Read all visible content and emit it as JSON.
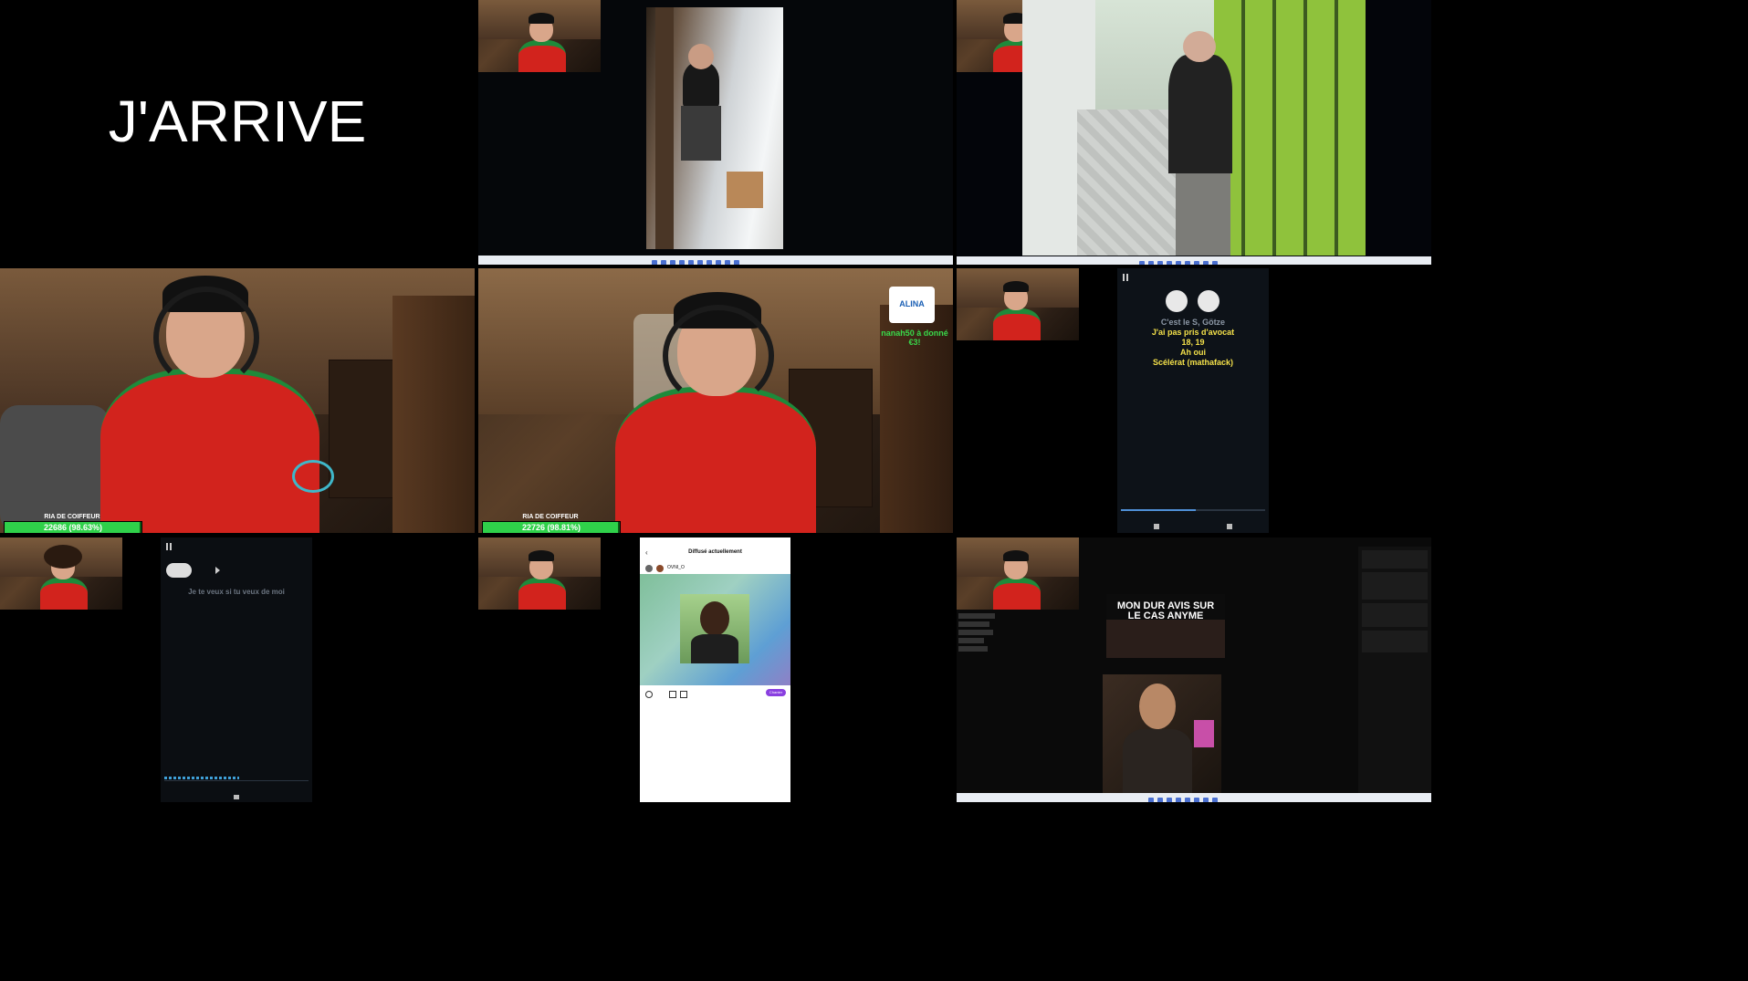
{
  "tiles": {
    "t1": {
      "big_text": "J'ARRIVE"
    },
    "t5": {
      "hp_label": "RIA DE COIFFEUR",
      "hp_text": "22686 (98.63%)",
      "hp_progress": 0.9863
    },
    "t6": {
      "hp_label": "RIA DE COIFFEUR",
      "hp_text": "22726 (98.81%)",
      "hp_progress": 0.9881,
      "donation_logo": "ALINA",
      "donation_text": "nanah50 à donné €3!"
    },
    "t7": {
      "lyrics": [
        "C'est le S, Götze",
        "J'ai pas pris d'avocat",
        "18, 19",
        "Ah oui",
        "Scélérat (mathafack)"
      ]
    },
    "t8": {
      "lyrics_line": "Je te veux si tu veux de moi"
    },
    "t9": {
      "header": "Diffusé actuellement",
      "username": "OVNI_O",
      "button": "Chanter"
    },
    "t10": {
      "thumb_title": "MON DUR AVIS SUR LE CAS ANYME"
    }
  },
  "colors": {
    "hp_fill": "#2fd14a",
    "donation_text": "#39d84a",
    "lyric_active": "#f3e04a",
    "lyric_dim": "#8c97a5"
  }
}
